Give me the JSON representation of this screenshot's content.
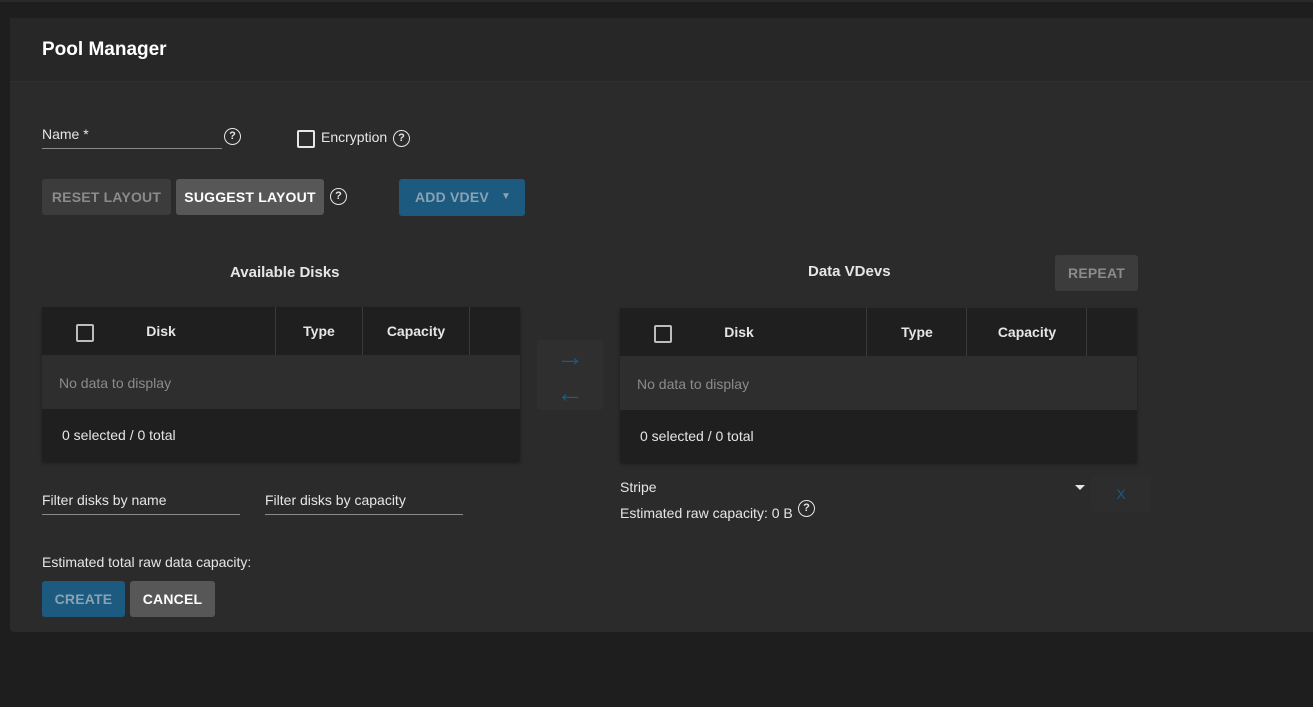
{
  "page": {
    "title": "Pool Manager"
  },
  "form": {
    "name_label": "Name *",
    "encryption_label": "Encryption",
    "help_glyph": "?"
  },
  "toolbar": {
    "reset_label": "RESET LAYOUT",
    "suggest_label": "SUGGEST LAYOUT",
    "add_vdev_label": "ADD VDEV",
    "add_vdev_caret": "▼"
  },
  "available": {
    "title": "Available Disks",
    "columns": [
      "Disk",
      "Type",
      "Capacity"
    ],
    "empty_text": "No data to display",
    "footer": "0 selected / 0 total",
    "filter_name_placeholder": "Filter disks by name",
    "filter_capacity_placeholder": "Filter disks by capacity"
  },
  "vdevs": {
    "title": "Data VDevs",
    "repeat_label": "REPEAT",
    "columns": [
      "Disk",
      "Type",
      "Capacity"
    ],
    "empty_text": "No data to display",
    "footer": "0 selected / 0 total",
    "layout_selected": "Stripe",
    "estimated_raw": "Estimated raw capacity: 0 B",
    "remove_label": "X"
  },
  "transfer": {
    "right_arrow": "→",
    "left_arrow": "←"
  },
  "summary": {
    "estimated_total": "Estimated total raw data capacity:"
  },
  "actions": {
    "create_label": "CREATE",
    "cancel_label": "CANCEL"
  },
  "colors": {
    "accent": "#1c5a80",
    "background": "#1e1e1e",
    "card": "#2b2b2b"
  },
  "icons": [
    "help-icon",
    "checkbox-icon",
    "arrow-right-icon",
    "arrow-left-icon",
    "dropdown-caret-icon"
  ]
}
